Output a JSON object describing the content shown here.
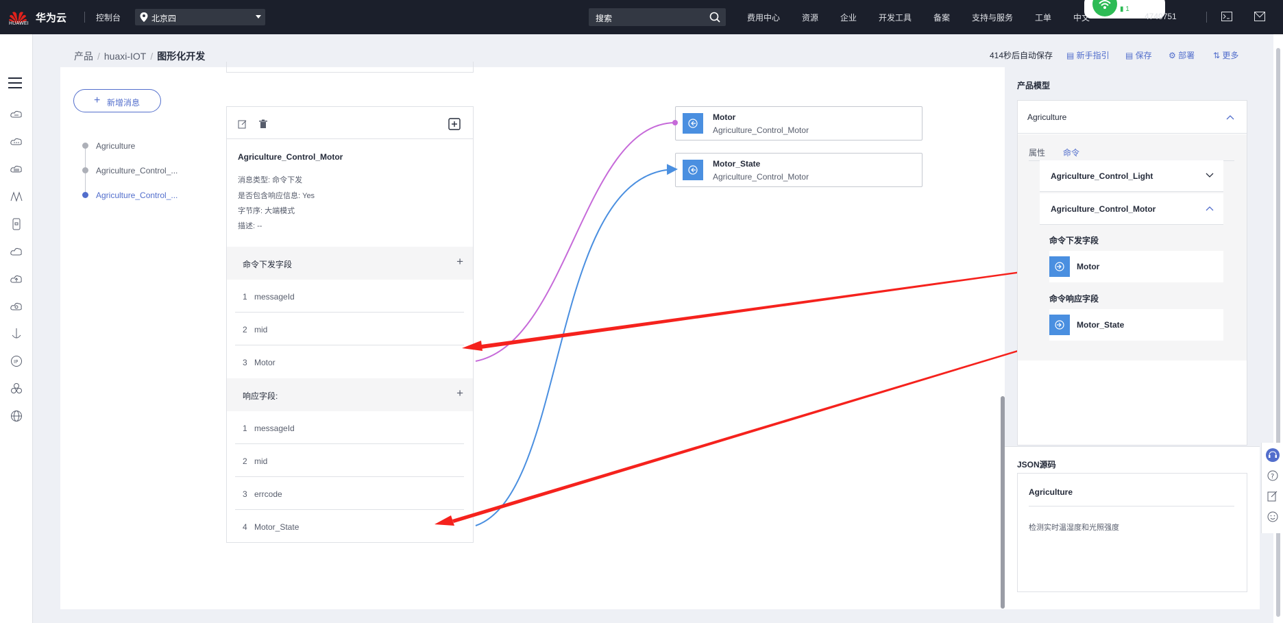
{
  "topbar": {
    "brand": "华为云",
    "logo_text": "HUAWEI",
    "console": "控制台",
    "region": "北京四",
    "search_placeholder": "搜索",
    "nav": [
      "费用中心",
      "资源",
      "企业",
      "开发工具",
      "备案",
      "支持与服务",
      "工单",
      "中文"
    ],
    "battery": "1",
    "phone": "4740751"
  },
  "breadcrumb": {
    "items": [
      "产品",
      "huaxi-IOT"
    ],
    "current": "图形化开发"
  },
  "toolbar": {
    "autosave": "414秒后自动保存",
    "guide": "新手指引",
    "save": "保存",
    "deploy": "部署",
    "more": "更多"
  },
  "left_panel": {
    "add_button": "新增消息",
    "tree": [
      {
        "label": "Agriculture",
        "active": false
      },
      {
        "label": "Agriculture_Control_...",
        "active": false
      },
      {
        "label": "Agriculture_Control_...",
        "active": true
      }
    ]
  },
  "message_card": {
    "title": "Agriculture_Control_Motor",
    "meta": [
      "消息类型: 命令下发",
      "是否包含响应信息: Yes",
      "字节序: 大端模式",
      "描述: --"
    ],
    "command_section": "命令下发字段",
    "command_fields": [
      {
        "index": "1",
        "name": "messageId"
      },
      {
        "index": "2",
        "name": "mid"
      },
      {
        "index": "3",
        "name": "Motor"
      }
    ],
    "response_section": "响应字段:",
    "response_fields": [
      {
        "index": "1",
        "name": "messageId"
      },
      {
        "index": "2",
        "name": "mid"
      },
      {
        "index": "3",
        "name": "errcode"
      },
      {
        "index": "4",
        "name": "Motor_State"
      }
    ]
  },
  "nodes": [
    {
      "name": "Motor",
      "sub": "Agriculture_Control_Motor"
    },
    {
      "name": "Motor_State",
      "sub": "Agriculture_Control_Motor"
    }
  ],
  "link_colors": {
    "motor": "#c66ad9",
    "motor_state": "#4a8fe0",
    "annotation": "#f5221d"
  },
  "product_model": {
    "title": "产品模型",
    "service": "Agriculture",
    "tabs": [
      "属性",
      "命令"
    ],
    "active_tab": "命令",
    "commands": [
      "Agriculture_Control_Light",
      "Agriculture_Control_Motor"
    ],
    "cmd_fields_label": "命令下发字段",
    "cmd_field": "Motor",
    "resp_fields_label": "命令响应字段",
    "resp_field": "Motor_State"
  },
  "json_source": {
    "title": "JSON源码",
    "name": "Agriculture",
    "description": "检测实时温湿度和光照强度"
  },
  "icons": [
    "search-icon",
    "location-pin-icon",
    "chevron-down-icon",
    "chevron-up-icon",
    "edit-icon",
    "delete-icon",
    "add-square-icon",
    "field-link-icon",
    "headset-icon",
    "help-icon",
    "feedback-icon",
    "smile-icon",
    "terminal-icon",
    "mail-icon"
  ]
}
